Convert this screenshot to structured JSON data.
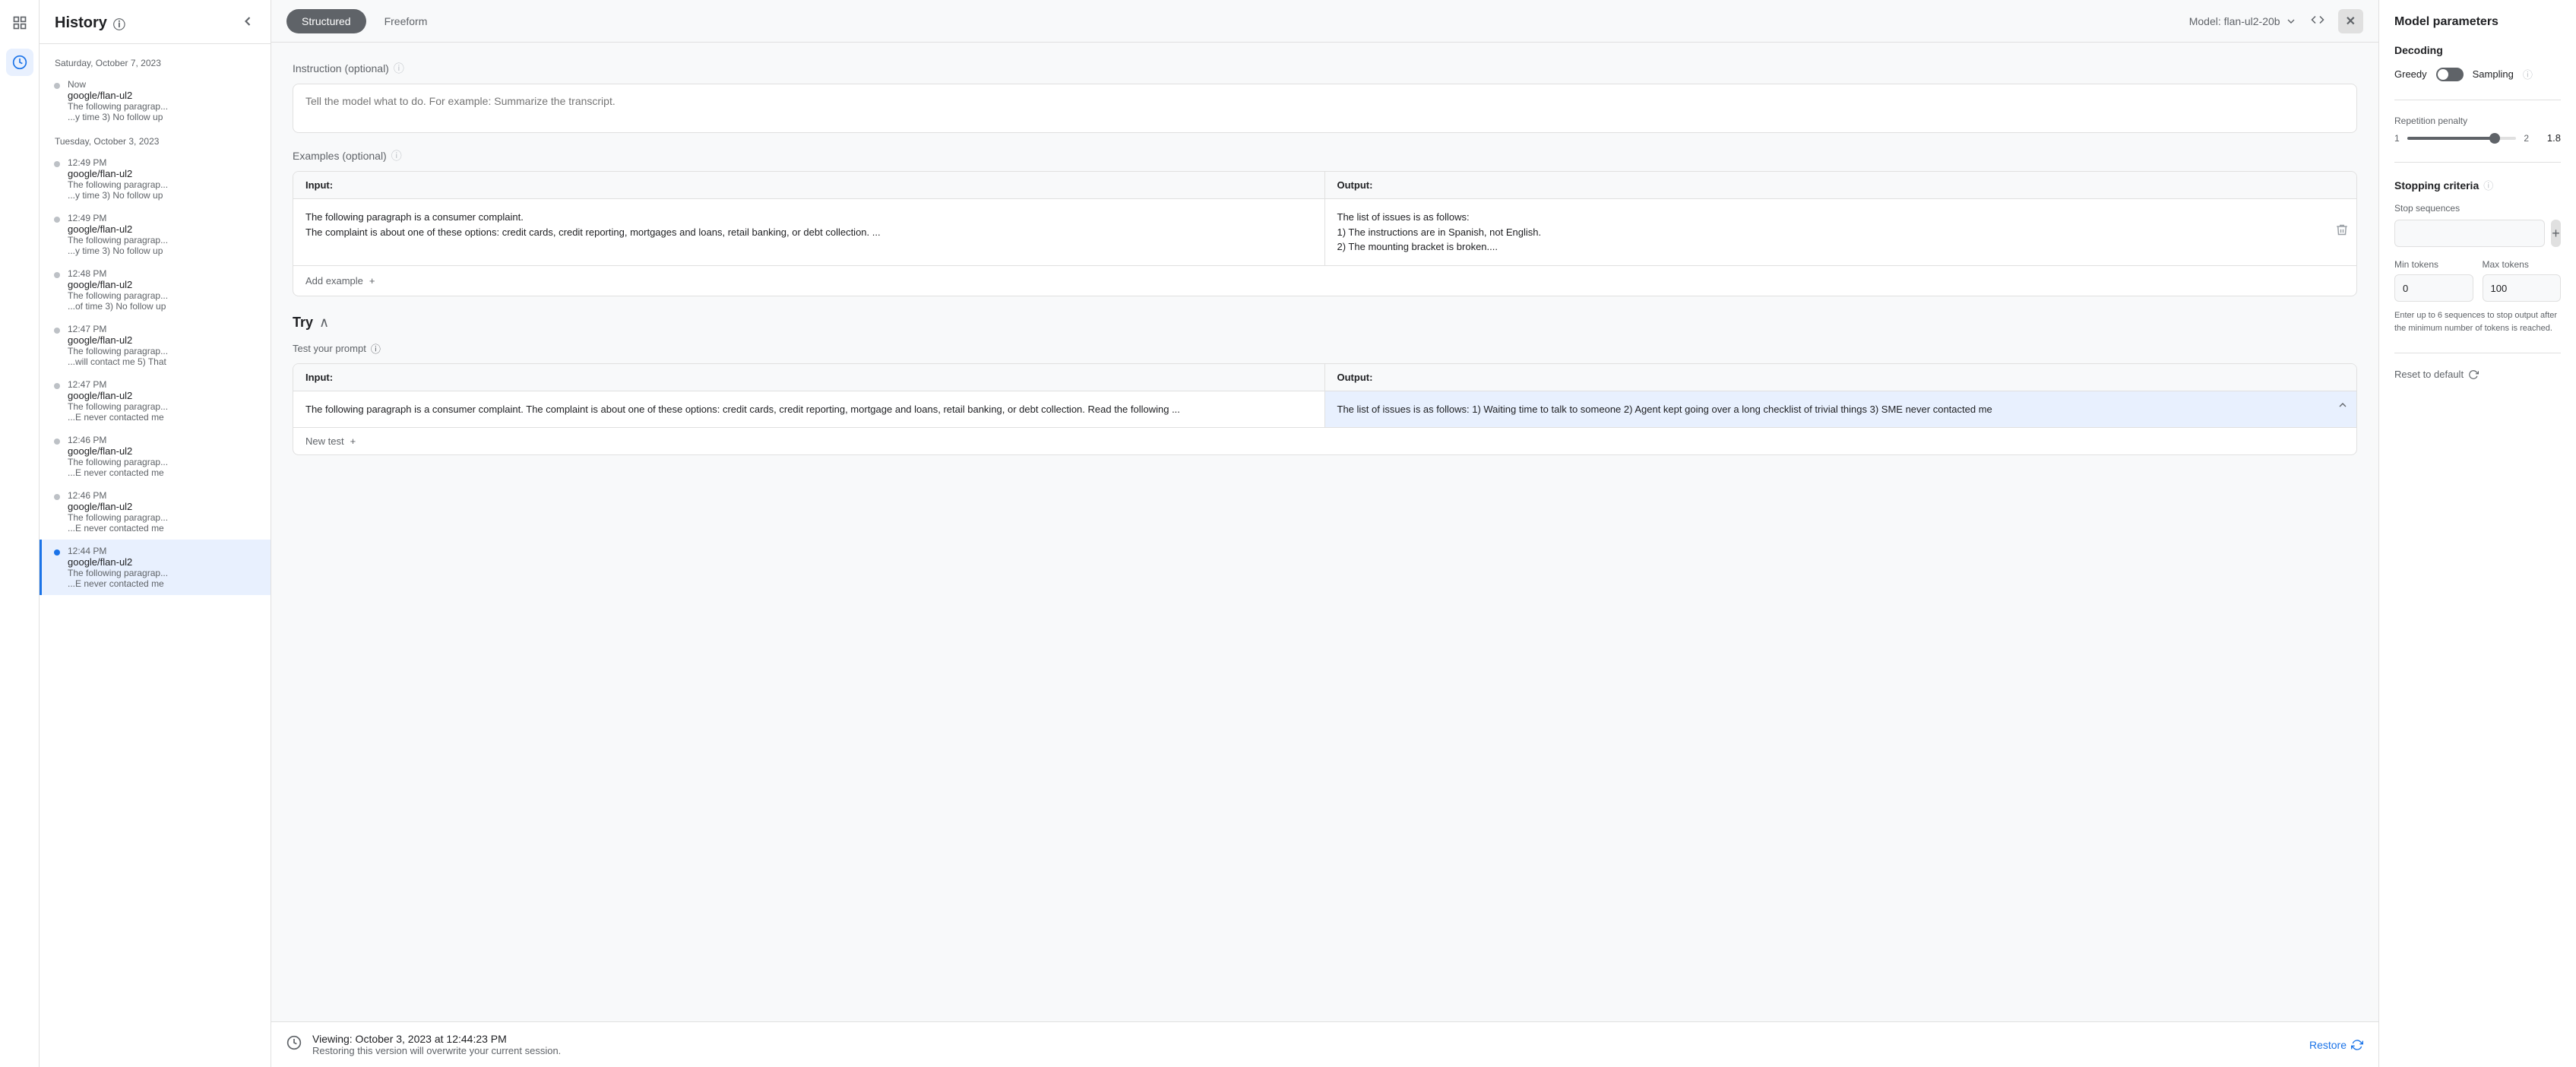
{
  "iconBar": {
    "icons": [
      {
        "name": "grid-icon",
        "symbol": "⊞"
      },
      {
        "name": "clock-icon",
        "symbol": "🕐"
      }
    ]
  },
  "historyPanel": {
    "title": "History",
    "closeLabel": "‹",
    "groups": [
      {
        "date": "Saturday, October 7, 2023",
        "items": [
          {
            "time": "Now",
            "model": "google/flan-ul2",
            "preview1": "The following paragrap...",
            "preview2": "...y time 3) No follow up",
            "active": false
          }
        ]
      },
      {
        "date": "Tuesday, October 3, 2023",
        "items": [
          {
            "time": "12:49 PM",
            "model": "google/flan-ul2",
            "preview1": "The following paragrap...",
            "preview2": "...y time 3) No follow up",
            "active": false
          },
          {
            "time": "12:49 PM",
            "model": "google/flan-ul2",
            "preview1": "The following paragrap...",
            "preview2": "...y time 3) No follow up",
            "active": false
          },
          {
            "time": "12:48 PM",
            "model": "google/flan-ul2",
            "preview1": "The following paragrap...",
            "preview2": "...of time 3) No follow up",
            "active": false
          },
          {
            "time": "12:47 PM",
            "model": "google/flan-ul2",
            "preview1": "The following paragrap...",
            "preview2": "...will contact me 5) That",
            "active": false
          },
          {
            "time": "12:47 PM",
            "model": "google/flan-ul2",
            "preview1": "The following paragrap...",
            "preview2": "...E never contacted me",
            "active": false
          },
          {
            "time": "12:46 PM",
            "model": "google/flan-ul2",
            "preview1": "The following paragrap...",
            "preview2": "...E never contacted me",
            "active": false
          },
          {
            "time": "12:46 PM",
            "model": "google/flan-ul2",
            "preview1": "The following paragrap...",
            "preview2": "...E never contacted me",
            "active": false
          },
          {
            "time": "12:44 PM",
            "model": "google/flan-ul2",
            "preview1": "The following paragrap...",
            "preview2": "...E never contacted me",
            "active": true
          }
        ]
      }
    ]
  },
  "tabs": {
    "structured": "Structured",
    "freeform": "Freeform",
    "activeTab": "structured"
  },
  "modelSelector": {
    "label": "Model: flan-ul2-20b"
  },
  "instruction": {
    "label": "Instruction (optional)",
    "placeholder": "Tell the model what to do. For example: Summarize the transcript."
  },
  "examples": {
    "label": "Examples (optional)",
    "inputHeader": "Input:",
    "outputHeader": "Output:",
    "rows": [
      {
        "input": "The following paragraph is a consumer complaint.\nThe complaint is about one of these options: credit cards, credit reporting, mortgages and loans, retail banking, or debt collection. ...",
        "output": "The list of issues is as follows:\n1) The instructions are in Spanish, not English.\n2) The mounting bracket is broken...."
      }
    ],
    "addExampleLabel": "Add example",
    "addIcon": "+"
  },
  "trySection": {
    "title": "Try",
    "chevron": "∧",
    "testPromptLabel": "Test your prompt",
    "inputHeader": "Input:",
    "outputHeader": "Output:",
    "testRows": [
      {
        "input": "The following paragraph is a consumer complaint. The complaint is about one of these options: credit cards, credit reporting, mortgage and loans, retail banking, or debt collection. Read the following ...",
        "output": "The list of issues is as follows: 1) Waiting time to talk to someone 2) Agent kept going over a long checklist of trivial things 3) SME never contacted me"
      }
    ],
    "newTestLabel": "New test",
    "newTestIcon": "+"
  },
  "restoreBanner": {
    "icon": "↩",
    "mainText": "Viewing: October 3, 2023 at 12:44:23 PM",
    "subText": "Restoring this version will overwrite your current session.",
    "restoreLabel": "Restore",
    "refreshIcon": "↻"
  },
  "rightPanel": {
    "title": "Model parameters",
    "decoding": {
      "sectionTitle": "Decoding",
      "greedyLabel": "Greedy",
      "samplingLabel": "Sampling"
    },
    "repetitionPenalty": {
      "label": "Repetition penalty",
      "min": "1",
      "max": "2",
      "value": "1.8",
      "fillPercent": 80
    },
    "stoppingCriteria": {
      "title": "Stopping criteria",
      "stopSequencesLabel": "Stop sequences",
      "minTokensLabel": "Min tokens",
      "minTokensValue": "0",
      "maxTokensLabel": "Max tokens",
      "maxTokensValue": "100",
      "note": "Enter up to 6 sequences to stop output after the minimum number of tokens is reached."
    },
    "resetDefault": "Reset to default"
  }
}
